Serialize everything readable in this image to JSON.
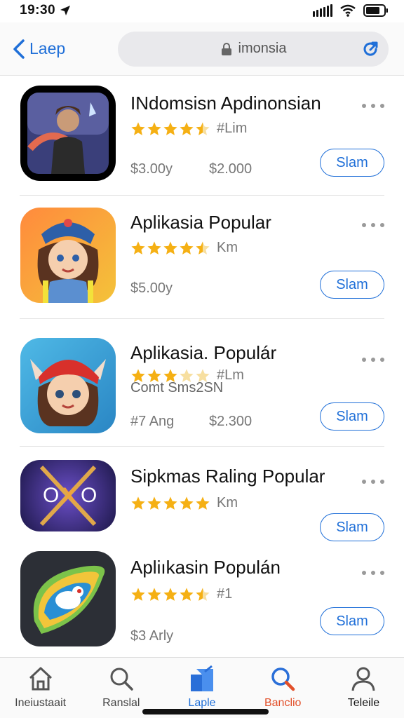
{
  "status": {
    "time": "19:30"
  },
  "nav": {
    "back_label": "Laep",
    "search_text": "imonsia"
  },
  "apps": [
    {
      "title": "INdomsisn Apdinonsian",
      "stars": 4.5,
      "rating_text": "#Lim",
      "sub": "",
      "price1": "$3.00y",
      "price2": "$2.000",
      "button": "Slam"
    },
    {
      "title": "Aplikasia Popular",
      "stars": 4.5,
      "rating_text": "Km",
      "sub": "",
      "price1": "$5.00y",
      "price2": "",
      "button": "Slam"
    },
    {
      "title": "Aplikasia. Populár",
      "stars": 3,
      "rating_text": "#Lm",
      "sub": "Comt Sms2SN",
      "price1": "#7 Ang",
      "price2": "$2.300",
      "button": "Slam"
    },
    {
      "title": "Sipkmas Raling Popular",
      "stars": 5,
      "rating_text": "Km",
      "sub": "",
      "price1": "",
      "price2": "",
      "button": "Slam"
    },
    {
      "title": "Apliıkasin Populán",
      "stars": 4.5,
      "rating_text": "#1",
      "sub": "",
      "price1": "$3 Arly",
      "price2": "",
      "button": "Slam"
    }
  ],
  "tabs": [
    {
      "label": "Ineiustaait",
      "icon": "home-icon",
      "color": "#444444"
    },
    {
      "label": "Ranslal",
      "icon": "search-icon",
      "color": "#444444"
    },
    {
      "label": "Laple",
      "icon": "apps-icon",
      "color": "#1f6fd8"
    },
    {
      "label": "Banclio",
      "icon": "magnifier-accent-icon",
      "color": "#e2502a"
    },
    {
      "label": "Teleile",
      "icon": "person-icon",
      "color": "#111111"
    }
  ],
  "colors": {
    "accent": "#1f6fd8",
    "star": "#f5b014"
  }
}
